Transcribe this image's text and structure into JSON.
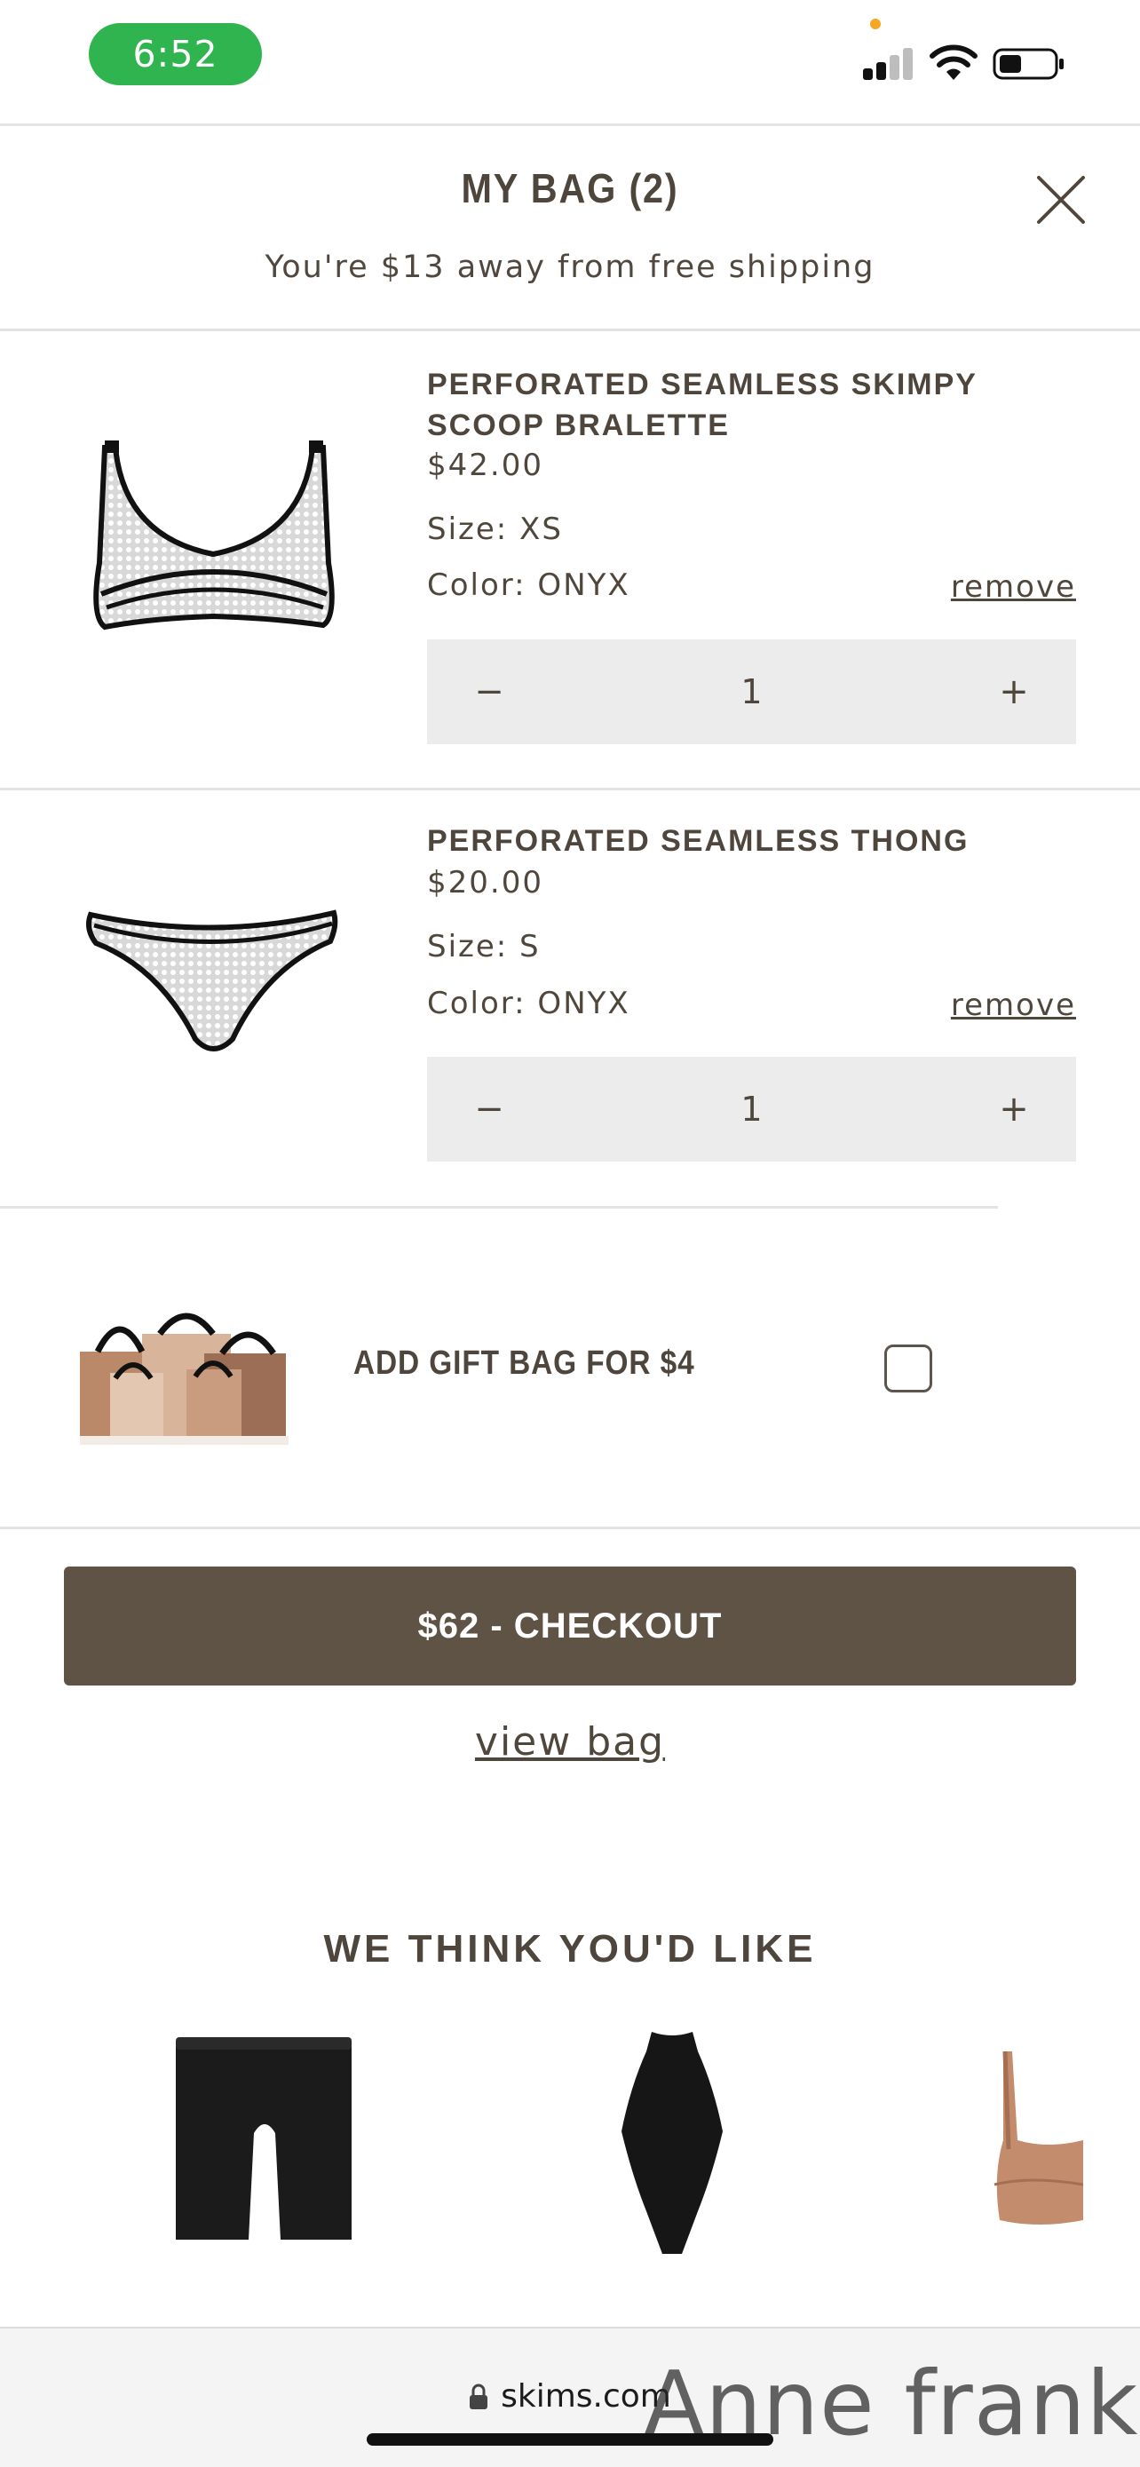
{
  "status_bar": {
    "time": "6:52",
    "icons": [
      "cellular-signal-icon",
      "wifi-icon",
      "battery-icon"
    ],
    "colors": {
      "time_pill": "#2fb44f",
      "privacy_dot": "#f5a623"
    }
  },
  "bag": {
    "title": "MY BAG (2)",
    "shipping_message": "You're $13 away from free shipping"
  },
  "items": [
    {
      "name": "PERFORATED SEAMLESS SKIMPY SCOOP BRALETTE",
      "price": "$42.00",
      "size": "Size: XS",
      "color": "Color: ONYX",
      "remove_label": "remove",
      "quantity": "1",
      "minus": "−",
      "plus": "+"
    },
    {
      "name": "PERFORATED SEAMLESS THONG",
      "price": "$20.00",
      "size": "Size: S",
      "color": "Color: ONYX",
      "remove_label": "remove",
      "quantity": "1",
      "minus": "−",
      "plus": "+"
    }
  ],
  "gift": {
    "label": "ADD GIFT BAG FOR $4",
    "checked": false
  },
  "checkout": {
    "button_label": "$62 - CHECKOUT",
    "view_bag_label": "view bag",
    "button_color": "#5e5345"
  },
  "recommendations": {
    "title": "WE THINK YOU'D LIKE"
  },
  "browser": {
    "url": "skims.com"
  },
  "watermark": "Anne frank"
}
